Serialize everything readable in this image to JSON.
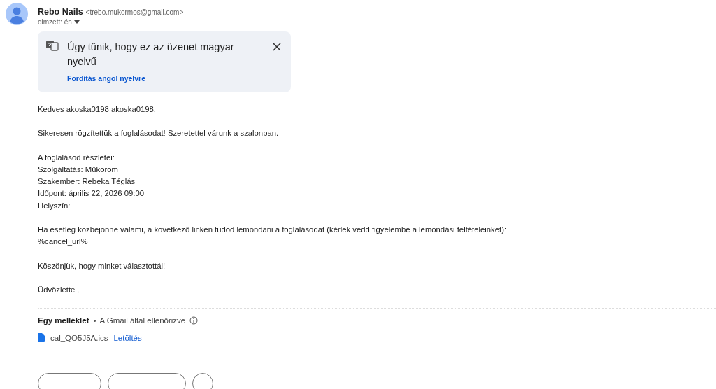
{
  "sender": {
    "name": "Rebo Nails",
    "email": "<trebo.mukormos@gmail.com>",
    "recipient": "címzett: én"
  },
  "translate_banner": {
    "message": "Úgy tűnik, hogy ez az üzenet magyar nyelvű",
    "action": "Fordítás angol nyelvre"
  },
  "body": [
    [
      "Kedves akoska0198 akoska0198,"
    ],
    [
      "Sikeresen rögzítettük a foglalásodat! Szeretettel várunk a szalonban."
    ],
    [
      "A foglalásod részletei:",
      "Szolgáltatás: Műköröm",
      "Szakember: Rebeka Téglási",
      "Időpont: április 22, 2026 09:00",
      "Helyszín:"
    ],
    [
      "Ha esetleg közbejönne valami, a következő linken tudod lemondani a foglalásodat (kérlek vedd figyelembe a lemondási feltételeinket):",
      "%cancel_url%"
    ],
    [
      "Köszönjük, hogy minket választottál!"
    ],
    [
      "Üdvözlettel,"
    ]
  ],
  "attachments": {
    "title": "Egy melléklet",
    "scan_note": "A Gmail által ellenőrizve",
    "files": [
      {
        "name": "cal_QO5J5A.ics",
        "action": "Letöltés"
      }
    ]
  }
}
